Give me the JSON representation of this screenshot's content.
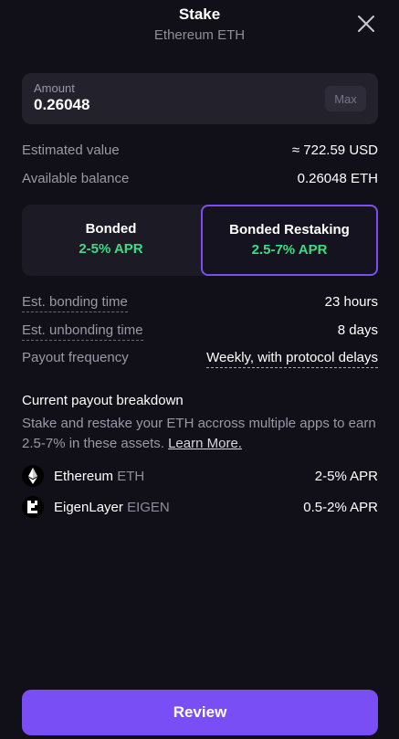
{
  "header": {
    "title": "Stake",
    "subtitle": "Ethereum ETH"
  },
  "amount": {
    "label": "Amount",
    "value": "0.26048",
    "max_label": "Max"
  },
  "summary": {
    "estimated_value_label": "Estimated value",
    "estimated_value": "≈ 722.59 USD",
    "available_balance_label": "Available balance",
    "available_balance": "0.26048 ETH"
  },
  "options": [
    {
      "name": "Bonded",
      "apr": "2-5% APR",
      "selected": false
    },
    {
      "name": "Bonded Restaking",
      "apr": "2.5-7% APR",
      "selected": true
    }
  ],
  "details": {
    "bonding_time_label": "Est. bonding time",
    "bonding_time": "23 hours",
    "unbonding_time_label": "Est. unbonding time",
    "unbonding_time": "8 days",
    "payout_frequency_label": "Payout frequency",
    "payout_frequency": "Weekly, with protocol delays"
  },
  "breakdown": {
    "title": "Current payout breakdown",
    "description": "Stake and restake your ETH accross multiple apps to earn 2.5-7% in these assets.",
    "learn_more": "Learn More.",
    "assets": [
      {
        "name": "Ethereum",
        "ticker": "ETH",
        "apr": "2-5% APR",
        "icon": "ethereum-icon"
      },
      {
        "name": "EigenLayer",
        "ticker": "EIGEN",
        "apr": "0.5-2% APR",
        "icon": "eigenlayer-icon"
      }
    ]
  },
  "review_label": "Review",
  "colors": {
    "background": "#111018",
    "accent": "#7a4ef5",
    "apr_green": "#3ddc84"
  }
}
